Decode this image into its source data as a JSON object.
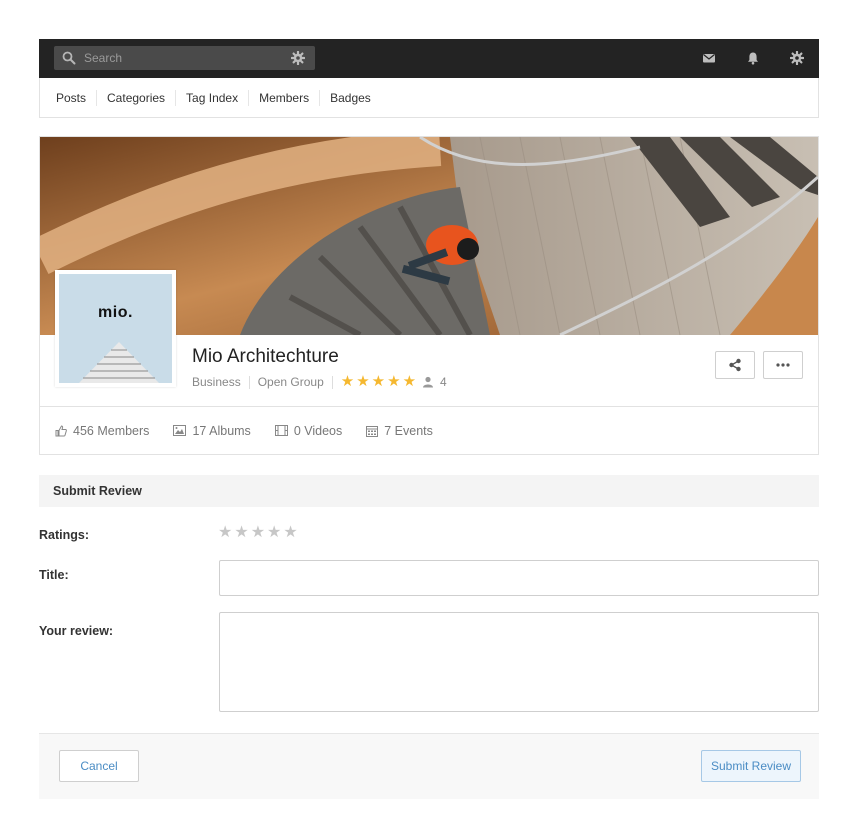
{
  "topbar": {
    "search_placeholder": "Search",
    "icons": [
      "search-icon",
      "gear-icon",
      "envelope-icon",
      "bell-icon",
      "gear-icon"
    ]
  },
  "nav": {
    "items": [
      "Posts",
      "Categories",
      "Tag Index",
      "Members",
      "Badges"
    ]
  },
  "group": {
    "avatar_text": "mio.",
    "name": "Mio Architechture",
    "category": "Business",
    "privacy": "Open Group",
    "rating": 5,
    "rating_max": 5,
    "reviewer_count": "4",
    "star_color": "#f5b830"
  },
  "stats": [
    {
      "icon": "thumbs-up-icon",
      "label": "456 Members"
    },
    {
      "icon": "image-icon",
      "label": "17 Albums"
    },
    {
      "icon": "film-icon",
      "label": "0 Videos"
    },
    {
      "icon": "calendar-icon",
      "label": "7 Events"
    }
  ],
  "review": {
    "heading": "Submit Review",
    "ratings_label": "Ratings:",
    "title_label": "Title:",
    "review_label": "Your review:",
    "title_value": "",
    "review_value": "",
    "rating_value": 0
  },
  "footer": {
    "cancel_label": "Cancel",
    "submit_label": "Submit Review",
    "accent_color": "#4a8cc4"
  }
}
